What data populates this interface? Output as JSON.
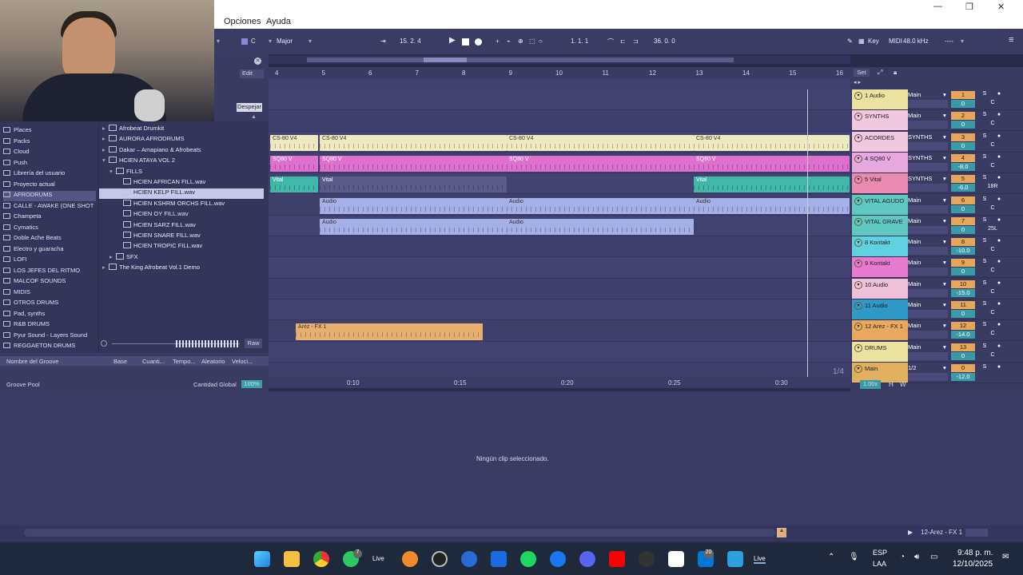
{
  "menu": {
    "options": "Opciones",
    "help": "Ayuda"
  },
  "window": {
    "minimize": "—",
    "maximize": "❐",
    "close": "✕"
  },
  "control": {
    "key": "C",
    "scale": "Major",
    "position": "15.  2.  4",
    "loop_start": "1.  1.  1",
    "loop_length": "36.  0.  0",
    "key_label": "Key",
    "midi_label": "MIDI",
    "sample_rate": "48.0 kHz",
    "dash": "----"
  },
  "browser_head": {
    "edit": "Edit",
    "clear": "Despejar"
  },
  "sidebar": {
    "items": [
      {
        "label": "Places"
      },
      {
        "label": "Packs"
      },
      {
        "label": "Cloud"
      },
      {
        "label": "Push"
      },
      {
        "label": "Librería del usuario"
      },
      {
        "label": "Proyecto actual"
      },
      {
        "label": "AFRODRUMS"
      },
      {
        "label": "CALLE - AWAKE (ONE SHOT"
      },
      {
        "label": "Champeta"
      },
      {
        "label": "Cymatics"
      },
      {
        "label": "Doble Ache Beats"
      },
      {
        "label": "Electro y guaracha"
      },
      {
        "label": "LOFI"
      },
      {
        "label": "LOS JEFES DEL RITMO"
      },
      {
        "label": "MALCOF SOUNDS"
      },
      {
        "label": "MIDIS"
      },
      {
        "label": "OTROS DRUMS"
      },
      {
        "label": "Pad, synths"
      },
      {
        "label": "R&B DRUMS"
      },
      {
        "label": "Pyur Sound - Layers Sound"
      },
      {
        "label": "REGGAETON DRUMS"
      }
    ]
  },
  "files": [
    {
      "label": "Afrobeat Drumkit"
    },
    {
      "label": "AURORA AFRODRUMS"
    },
    {
      "label": "Dakar – Amapiano & Afrobeats"
    },
    {
      "label": "HCIEN ATAYA VOL 2"
    },
    {
      "label": "FILLS"
    },
    {
      "label": "HCIEN AFRICAN FILL.wav"
    },
    {
      "label": "HCIEN KELP FILL.wav"
    },
    {
      "label": "HCIEN KSHRM ORCHS FILL.wav"
    },
    {
      "label": "HCIEN OY FILL.wav"
    },
    {
      "label": "HCIEN SARZ FILL.wav"
    },
    {
      "label": "HCIEN SNARE FILL.wav"
    },
    {
      "label": "HCIEN TROPIC FILL.wav"
    },
    {
      "label": "SFX"
    },
    {
      "label": "The King Afrobeat Vol.1 Demo"
    }
  ],
  "preview": {
    "raw": "Raw"
  },
  "groove": {
    "cols": [
      "Nombre del Groove",
      "Base",
      "Cuanti...",
      "Tempo...",
      "Aleatorio",
      "Veloci..."
    ],
    "pool": "Groove Pool",
    "global": "Cantidad Global",
    "global_val": "100%"
  },
  "ruler": [
    "4",
    "5",
    "6",
    "7",
    "8",
    "9",
    "10",
    "11",
    "12",
    "13",
    "14",
    "15",
    "16"
  ],
  "set_label": "Set",
  "time_ticks": [
    "0:10",
    "0:15",
    "0:20",
    "0:25",
    "0:30"
  ],
  "clips": {
    "cs80": "CS-80 V4",
    "sq80": "SQ80 V",
    "vital": "Vital",
    "audio": "Audio",
    "arez": "Arez - FX 1"
  },
  "tracks": [
    {
      "name": "1 Audio",
      "route": "Main",
      "num": "1",
      "vol": "0",
      "pan": "C",
      "color": "#eae3a0"
    },
    {
      "name": "SYNTHS",
      "route": "Main",
      "num": "2",
      "vol": "0",
      "pan": "C",
      "color": "#f0c8e0"
    },
    {
      "name": "ACORDES",
      "route": "SYNTHS",
      "num": "3",
      "vol": "0",
      "pan": "C",
      "color": "#f0c8e0"
    },
    {
      "name": "4 SQ80 V",
      "route": "SYNTHS",
      "num": "4",
      "vol": "-8.0",
      "pan": "C",
      "color": "#e7a8df"
    },
    {
      "name": "5 Vital",
      "route": "SYNTHS",
      "num": "5",
      "vol": "-6.0",
      "pan": "18R",
      "color": "#e98ab0"
    },
    {
      "name": "VITAL AGUDO",
      "route": "Main",
      "num": "6",
      "vol": "0",
      "pan": "C",
      "color": "#5fc8c0"
    },
    {
      "name": "VITAL GRAVE",
      "route": "Main",
      "num": "7",
      "vol": "0",
      "pan": "25L",
      "color": "#5fc8c0"
    },
    {
      "name": "8 Kontakt",
      "route": "Main",
      "num": "8",
      "vol": "-10.0",
      "pan": "C",
      "color": "#5fd0e0"
    },
    {
      "name": "9 Kontakt",
      "route": "Main",
      "num": "9",
      "vol": "0",
      "pan": "C",
      "color": "#e77ad0"
    },
    {
      "name": "10 Audio",
      "route": "Main",
      "num": "10",
      "vol": "-15.0",
      "pan": "C",
      "color": "#f0c0d8"
    },
    {
      "name": "11 Audio",
      "route": "Main",
      "num": "11",
      "vol": "0",
      "pan": "C",
      "color": "#2f9ac8"
    },
    {
      "name": "12 Arez - FX 1",
      "route": "Main",
      "num": "12",
      "vol": "-14.0",
      "pan": "C",
      "color": "#e8a860"
    },
    {
      "name": "DRUMS",
      "route": "Main",
      "num": "13",
      "vol": "0",
      "pan": "C",
      "color": "#eae3a0"
    },
    {
      "name": "Main",
      "route": "1/2",
      "num": "0",
      "vol": "-12.0",
      "pan": "",
      "color": "#e0b060"
    }
  ],
  "fraction": "1/4",
  "zoom": "1.00x",
  "hw": {
    "h": "H",
    "w": "W"
  },
  "no_clip": "Ningún clip seleccionado.",
  "status": {
    "track": "12-Arez - FX 1"
  },
  "tray": {
    "lang1": "ESP",
    "lang2": "LAA",
    "time": "9:48 p. m.",
    "date": "12/10/2025",
    "badge1": "7",
    "badge2": "20"
  },
  "taskbar_live": "Live"
}
